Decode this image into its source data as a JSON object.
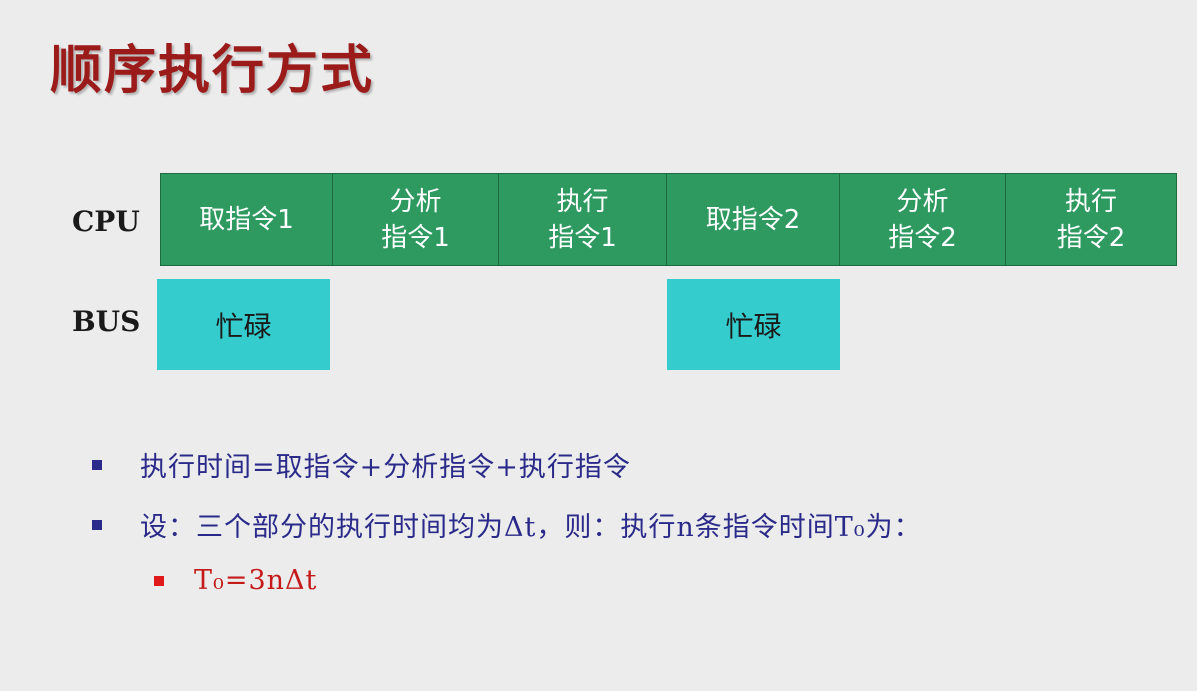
{
  "title": "顺序执行方式",
  "labels": {
    "cpu": "CPU",
    "bus": "BUS"
  },
  "cpu_stages": [
    "取指令1",
    "分析\n指令1",
    "执行\n指令1",
    "取指令2",
    "分析\n指令2",
    "执行\n指令2"
  ],
  "bus_blocks": [
    "忙碌",
    "忙碌"
  ],
  "bullets": [
    "执行时间=取指令+分析指令+执行指令",
    "设：三个部分的执行时间均为Δt，则：执行n条指令时间T₀为："
  ],
  "formula": "T₀=3nΔt",
  "colors": {
    "title": "#9b1a1a",
    "cpu_cell": "#2e9a60",
    "bus_block": "#34cccc",
    "bullet_blue": "#2a2a8a",
    "bullet_red": "#c41a1a"
  }
}
